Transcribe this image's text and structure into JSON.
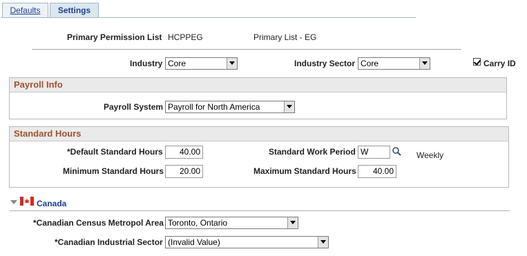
{
  "tabs": [
    {
      "label": "Defaults"
    },
    {
      "label": "Settings"
    }
  ],
  "primary_permission": {
    "label": "Primary Permission List",
    "value": "HCPPEG",
    "description": "Primary List - EG"
  },
  "industry": {
    "label": "Industry",
    "value": "Core"
  },
  "industry_sector": {
    "label": "Industry Sector",
    "value": "Core"
  },
  "carry_id": {
    "label": "Carry ID",
    "checked": true
  },
  "payroll_info": {
    "title": "Payroll Info",
    "payroll_system_label": "Payroll System",
    "payroll_system_value": "Payroll for North America"
  },
  "standard_hours": {
    "title": "Standard Hours",
    "default_label": "*Default Standard Hours",
    "default_value": "40.00",
    "minimum_label": "Minimum Standard Hours",
    "minimum_value": "20.00",
    "work_period_label": "Standard Work Period",
    "work_period_value": "W",
    "work_period_desc": "Weekly",
    "maximum_label": "Maximum Standard Hours",
    "maximum_value": "40.00"
  },
  "canada": {
    "title": "Canada",
    "cma_label": "*Canadian Census Metropol Area",
    "cma_value": "Toronto, Ontario",
    "industrial_label": "*Canadian Industrial Sector",
    "industrial_value": "(Invalid Value)"
  },
  "icons": {
    "lookup": "magnifier-icon",
    "collapse": "triangle-down-icon",
    "flag": "canada-flag-icon"
  },
  "colors": {
    "section_title": "#a0522d",
    "tab_text": "#1c3f95"
  }
}
